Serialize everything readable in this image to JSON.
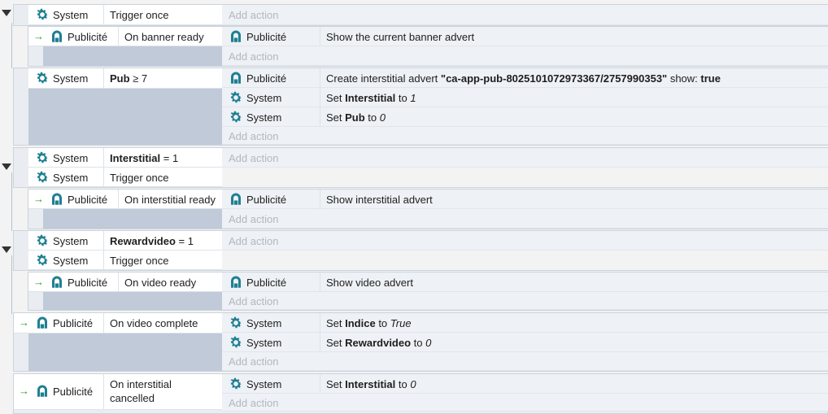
{
  "labels": {
    "system": "System",
    "publicite": "Publicité",
    "add_action": "Add action"
  },
  "colors": {
    "accent": "#1f7f93",
    "trigger_arrow": "#2f9a3a"
  },
  "events": {
    "e1": {
      "cond": "Trigger once"
    },
    "e1s": {
      "cond": "On banner ready",
      "act": "Show the current banner advert"
    },
    "e2": {
      "cond_var": "Pub",
      "cond_rest": " ≥ 7",
      "act1_pre": "Create interstitial advert ",
      "act1_id": "\"ca-app-pub-8025101072973367/2757990353\"",
      "act1_mid": " show: ",
      "act1_val": "true",
      "act2_pre": "Set ",
      "act2_var": "Interstitial",
      "act2_mid": " to ",
      "act2_val": "1",
      "act3_pre": "Set ",
      "act3_var": "Pub",
      "act3_mid": " to ",
      "act3_val": "0"
    },
    "e3": {
      "cond1_var": "Interstitial",
      "cond1_rest": " = 1",
      "cond2": "Trigger once"
    },
    "e3s": {
      "cond": "On interstitial ready",
      "act": "Show interstitial advert"
    },
    "e4": {
      "cond1_var": "Rewardvideo",
      "cond1_rest": " = 1",
      "cond2": "Trigger once"
    },
    "e4s": {
      "cond": "On video ready",
      "act": "Show video advert"
    },
    "e5": {
      "cond": "On video complete",
      "act1_pre": "Set ",
      "act1_var": "Indice",
      "act1_mid": " to ",
      "act1_val": "True",
      "act2_pre": "Set ",
      "act2_var": "Rewardvideo",
      "act2_mid": " to ",
      "act2_val": "0"
    },
    "e6": {
      "cond_line1": "On interstitial",
      "cond_line2": "cancelled",
      "act1_pre": "Set ",
      "act1_var": "Interstitial",
      "act1_mid": " to ",
      "act1_val": "0"
    }
  }
}
